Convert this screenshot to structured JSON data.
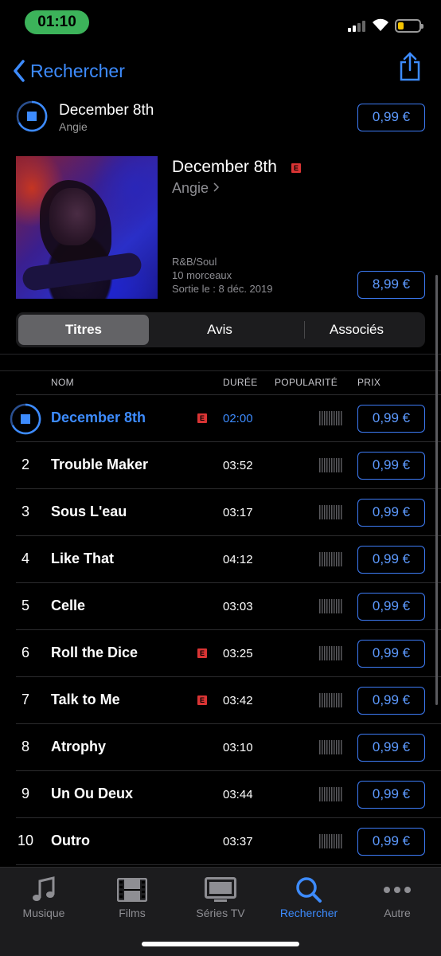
{
  "status": {
    "time": "01:10"
  },
  "nav": {
    "back_label": "Rechercher"
  },
  "now_playing": {
    "title": "December 8th",
    "artist": "Angie",
    "price": "0,99 €"
  },
  "album": {
    "title": "December 8th",
    "explicit": "E",
    "artist": "Angie",
    "genre": "R&B/Soul",
    "track_count": "10 morceaux",
    "release": "Sortie le : 8 déc. 2019",
    "price": "8,99 €"
  },
  "tabs_segment": [
    "Titres",
    "Avis",
    "Associés"
  ],
  "columns": {
    "name": "NOM",
    "duration": "DURÉE",
    "popularity": "POPULARITÉ",
    "price": "PRIX"
  },
  "tracks": [
    {
      "num": "",
      "name": "December 8th",
      "explicit": "E",
      "duration": "02:00",
      "price": "0,99 €",
      "playing": true
    },
    {
      "num": "2",
      "name": "Trouble Maker",
      "explicit": "",
      "duration": "03:52",
      "price": "0,99 €"
    },
    {
      "num": "3",
      "name": "Sous L'eau",
      "explicit": "",
      "duration": "03:17",
      "price": "0,99 €"
    },
    {
      "num": "4",
      "name": "Like That",
      "explicit": "",
      "duration": "04:12",
      "price": "0,99 €"
    },
    {
      "num": "5",
      "name": "Celle",
      "explicit": "",
      "duration": "03:03",
      "price": "0,99 €"
    },
    {
      "num": "6",
      "name": "Roll the Dice",
      "explicit": "E",
      "duration": "03:25",
      "price": "0,99 €"
    },
    {
      "num": "7",
      "name": "Talk to Me",
      "explicit": "E",
      "duration": "03:42",
      "price": "0,99 €"
    },
    {
      "num": "8",
      "name": "Atrophy",
      "explicit": "",
      "duration": "03:10",
      "price": "0,99 €"
    },
    {
      "num": "9",
      "name": "Un Ou Deux",
      "explicit": "",
      "duration": "03:44",
      "price": "0,99 €"
    },
    {
      "num": "10",
      "name": "Outro",
      "explicit": "",
      "duration": "03:37",
      "price": "0,99 €"
    }
  ],
  "tabbar": [
    {
      "label": "Musique",
      "icon": "music-note-icon"
    },
    {
      "label": "Films",
      "icon": "film-icon"
    },
    {
      "label": "Séries TV",
      "icon": "tv-icon"
    },
    {
      "label": "Rechercher",
      "icon": "search-icon",
      "active": true
    },
    {
      "label": "Autre",
      "icon": "more-icon"
    }
  ],
  "colors": {
    "accent": "#3d8bfd",
    "explicit": "#d93434",
    "time_pill": "#3cb35a"
  }
}
